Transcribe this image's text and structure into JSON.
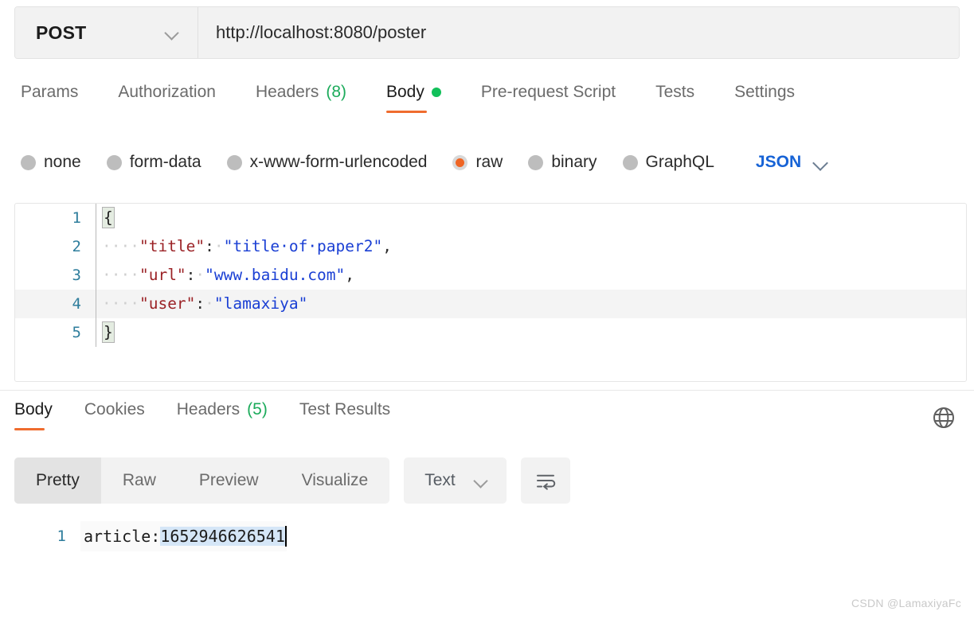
{
  "request": {
    "method": "POST",
    "method_chevron_icon": "chevron-down-icon",
    "url": "http://localhost:8080/poster",
    "url_placeholder": "Enter request URL",
    "tabs": [
      {
        "label": "Params",
        "count": "",
        "active": false,
        "dot": false
      },
      {
        "label": "Authorization",
        "count": "",
        "active": false,
        "dot": false
      },
      {
        "label": "Headers",
        "count": "(8)",
        "active": false,
        "dot": false
      },
      {
        "label": "Body",
        "count": "",
        "active": true,
        "dot": true
      },
      {
        "label": "Pre-request Script",
        "count": "",
        "active": false,
        "dot": false
      },
      {
        "label": "Tests",
        "count": "",
        "active": false,
        "dot": false
      },
      {
        "label": "Settings",
        "count": "",
        "active": false,
        "dot": false
      }
    ],
    "body_types": [
      {
        "label": "none",
        "selected": false
      },
      {
        "label": "form-data",
        "selected": false
      },
      {
        "label": "x-www-form-urlencoded",
        "selected": false
      },
      {
        "label": "raw",
        "selected": true
      },
      {
        "label": "binary",
        "selected": false
      },
      {
        "label": "GraphQL",
        "selected": false
      }
    ],
    "raw_format": "JSON",
    "raw_format_chevron_icon": "chevron-down-icon",
    "editor": {
      "lines": [
        {
          "no": "1",
          "active": false
        },
        {
          "no": "2",
          "active": false
        },
        {
          "no": "3",
          "active": false
        },
        {
          "no": "4",
          "active": true
        },
        {
          "no": "5",
          "active": false
        }
      ],
      "line1_brace": "{",
      "line2_indent": "····",
      "line2_key": "\"title\"",
      "line2_colon": ":",
      "line2_space": "·",
      "line2_value": "\"title·of·paper2\"",
      "line2_comma": ",",
      "line3_indent": "····",
      "line3_key": "\"url\"",
      "line3_colon": ":",
      "line3_space": "·",
      "line3_value": "\"www.baidu.com\"",
      "line3_comma": ",",
      "line4_indent": "····",
      "line4_key": "\"user\"",
      "line4_colon": ":",
      "line4_space": "·",
      "line4_value": "\"lamaxiya\"",
      "line5_brace": "}"
    }
  },
  "response": {
    "tabs": [
      {
        "label": "Body",
        "count": "",
        "active": true
      },
      {
        "label": "Cookies",
        "count": "",
        "active": false
      },
      {
        "label": "Headers",
        "count": "(5)",
        "active": false
      },
      {
        "label": "Test Results",
        "count": "",
        "active": false
      }
    ],
    "globe_icon": "globe-icon",
    "view_modes": [
      {
        "label": "Pretty",
        "active": true
      },
      {
        "label": "Raw",
        "active": false
      },
      {
        "label": "Preview",
        "active": false
      },
      {
        "label": "Visualize",
        "active": false
      }
    ],
    "format": "Text",
    "format_chevron_icon": "chevron-down-icon",
    "wrap_icon": "word-wrap-icon",
    "body": {
      "line_no": "1",
      "text_plain": "article:",
      "text_selected": "1652946626541"
    }
  },
  "watermark": "CSDN @LamaxiyaFc",
  "colors": {
    "accent": "#ef6c2e",
    "count_green": "#1cab5b",
    "status_dot": "#12c05a",
    "link_blue": "#1763d6",
    "selection_blue": "#d5e6f7",
    "gutter_teal": "#2e7d9c",
    "json_key": "#9b2226",
    "json_value": "#1a3fd4"
  }
}
